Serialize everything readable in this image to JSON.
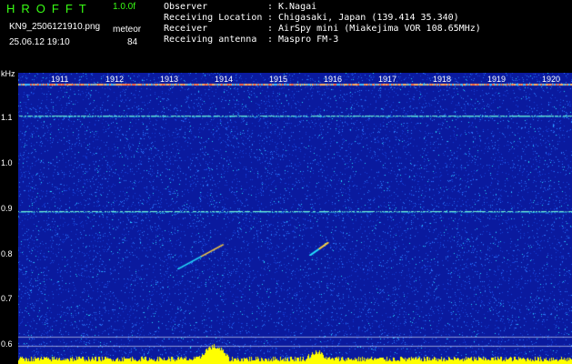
{
  "header": {
    "app_title": "HROFFT",
    "version": "1.0.0f",
    "filename": "KN9_2506121910.png",
    "mode": "meteor",
    "datetime": "25.06.12 19:10",
    "count": "84",
    "info": [
      {
        "label": "Observer",
        "sep": ":",
        "value": "K.Nagai"
      },
      {
        "label": "Receiving Location",
        "sep": ":",
        "value": "Chigasaki, Japan (139.414 35.340)"
      },
      {
        "label": "Receiver",
        "sep": ":",
        "value": "AirSpy mini (Miakejima VOR 108.65MHz)"
      },
      {
        "label": "Receiving antenna",
        "sep": ":",
        "value": "Maspro FM-3"
      }
    ]
  },
  "axis": {
    "unit": "kHz",
    "y_ticks": [
      "1.1",
      "1.0",
      "0.9",
      "0.8",
      "0.7",
      "0.6"
    ],
    "x_ticks": [
      "1911",
      "1912",
      "1913",
      "1914",
      "1915",
      "1916",
      "1917",
      "1918",
      "1919",
      "1920"
    ]
  },
  "colors": {
    "background": "#0a1a9e",
    "noise_light": "#2a7cff",
    "noise_cyan": "#25e0ff",
    "signal_line": "#7cffd4",
    "meteor": "#ffd040",
    "baseline": "#ffff00",
    "title": "#39ff14"
  }
}
